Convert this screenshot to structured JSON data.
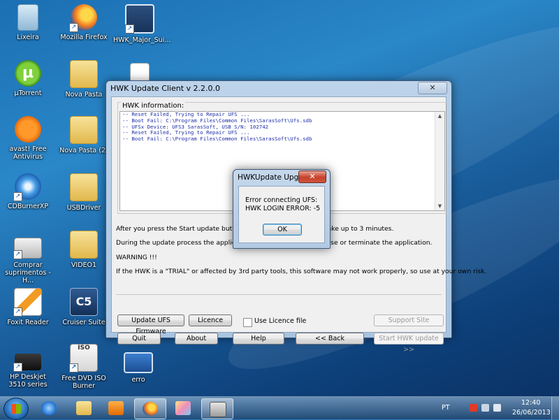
{
  "desktop": {
    "icons": [
      {
        "label": "Lixeira"
      },
      {
        "label": "Mozilla Firefox"
      },
      {
        "label": "HWK_Major_Sui..."
      },
      {
        "label": "µTorrent"
      },
      {
        "label": "Nova Pasta"
      },
      {
        "label": "avast! Free Antivirus"
      },
      {
        "label": "Nova Pasta (2)"
      },
      {
        "label": "CDBurnerXP"
      },
      {
        "label": "USBDriver"
      },
      {
        "label": "Comprar suprimentos - H..."
      },
      {
        "label": "VIDEO1"
      },
      {
        "label": "Foxit Reader"
      },
      {
        "label": "Cruiser Suite"
      },
      {
        "label": "HP Deskjet 3510 series"
      },
      {
        "label": "Free DVD ISO Burner"
      },
      {
        "label": "erro"
      }
    ],
    "icon_glyphs": {
      "utorrent": "µ",
      "cruiser": "C5",
      "dvd": "ISO",
      "shortcut_arrow": "↗"
    }
  },
  "main_window": {
    "title": "HWK Update Client  v 2.2.0.0",
    "close_glyph": "✕",
    "info_group_label": "HWK information:",
    "log_lines": [
      "-- Reset Failed, Trying to Repair UFS ...",
      "-- Boot Fail: C:\\Program Files\\Common Files\\SarasSoft\\Ufs.sdb",
      "-- UFSx Device: UFS3 SarasSoft, USB S/N: 102742",
      "-- Reset Failed, Trying to Repair UFS ...",
      "-- Boot Fail: C:\\Program Files\\Common Files\\SarasSoft\\Ufs.sdb"
    ],
    "info_lines": {
      "line1_left": "After you press the Start update button, the up",
      "line1_right": "take up to 3 minutes.",
      "line2_left": "During the update process the application ma",
      "line2_right": "lose or terminate the application.",
      "warning": "WARNING !!!",
      "trial": "If the HWK is a \"TRIAL\" or affected by 3rd party tools, this software may not work properly, so use at your own risk."
    },
    "buttons": {
      "update_ufs_firmware": "Update UFS Firmware",
      "licence": "Licence",
      "use_licence_file": "Use Licence file",
      "support_site": "Support Site",
      "quit": "Quit",
      "about": "About",
      "help": "Help",
      "back": "<< Back",
      "start_update": "Start HWK update >>"
    }
  },
  "dialog": {
    "title": "HWKUpdate Upg...",
    "close_glyph": "✕",
    "message_line1": "Error connecting UFS:",
    "message_line2": "HWK LOGIN ERROR: -5",
    "ok_label": "OK"
  },
  "taskbar": {
    "language": "PT",
    "time": "12:40",
    "date": "26/06/2013"
  },
  "colors": {
    "log_text": "#1e2ea8",
    "close_button": "#c7412b",
    "desktop_background": "#1b6fb3"
  }
}
